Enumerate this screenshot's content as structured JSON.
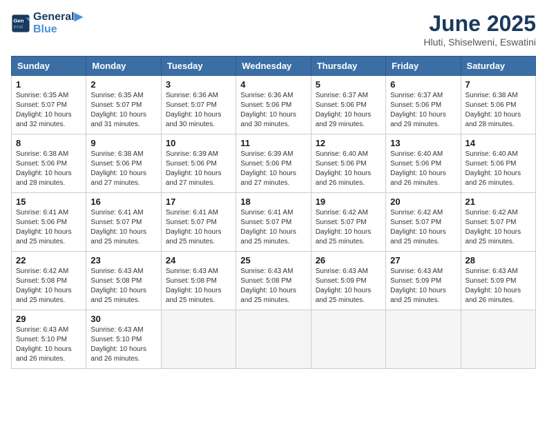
{
  "header": {
    "logo_line1": "General",
    "logo_line2": "Blue",
    "month_year": "June 2025",
    "location": "Hluti, Shiselweni, Eswatini"
  },
  "weekdays": [
    "Sunday",
    "Monday",
    "Tuesday",
    "Wednesday",
    "Thursday",
    "Friday",
    "Saturday"
  ],
  "weeks": [
    [
      {
        "day": "1",
        "info": "Sunrise: 6:35 AM\nSunset: 5:07 PM\nDaylight: 10 hours\nand 32 minutes."
      },
      {
        "day": "2",
        "info": "Sunrise: 6:35 AM\nSunset: 5:07 PM\nDaylight: 10 hours\nand 31 minutes."
      },
      {
        "day": "3",
        "info": "Sunrise: 6:36 AM\nSunset: 5:07 PM\nDaylight: 10 hours\nand 30 minutes."
      },
      {
        "day": "4",
        "info": "Sunrise: 6:36 AM\nSunset: 5:06 PM\nDaylight: 10 hours\nand 30 minutes."
      },
      {
        "day": "5",
        "info": "Sunrise: 6:37 AM\nSunset: 5:06 PM\nDaylight: 10 hours\nand 29 minutes."
      },
      {
        "day": "6",
        "info": "Sunrise: 6:37 AM\nSunset: 5:06 PM\nDaylight: 10 hours\nand 29 minutes."
      },
      {
        "day": "7",
        "info": "Sunrise: 6:38 AM\nSunset: 5:06 PM\nDaylight: 10 hours\nand 28 minutes."
      }
    ],
    [
      {
        "day": "8",
        "info": "Sunrise: 6:38 AM\nSunset: 5:06 PM\nDaylight: 10 hours\nand 28 minutes."
      },
      {
        "day": "9",
        "info": "Sunrise: 6:38 AM\nSunset: 5:06 PM\nDaylight: 10 hours\nand 27 minutes."
      },
      {
        "day": "10",
        "info": "Sunrise: 6:39 AM\nSunset: 5:06 PM\nDaylight: 10 hours\nand 27 minutes."
      },
      {
        "day": "11",
        "info": "Sunrise: 6:39 AM\nSunset: 5:06 PM\nDaylight: 10 hours\nand 27 minutes."
      },
      {
        "day": "12",
        "info": "Sunrise: 6:40 AM\nSunset: 5:06 PM\nDaylight: 10 hours\nand 26 minutes."
      },
      {
        "day": "13",
        "info": "Sunrise: 6:40 AM\nSunset: 5:06 PM\nDaylight: 10 hours\nand 26 minutes."
      },
      {
        "day": "14",
        "info": "Sunrise: 6:40 AM\nSunset: 5:06 PM\nDaylight: 10 hours\nand 26 minutes."
      }
    ],
    [
      {
        "day": "15",
        "info": "Sunrise: 6:41 AM\nSunset: 5:06 PM\nDaylight: 10 hours\nand 25 minutes."
      },
      {
        "day": "16",
        "info": "Sunrise: 6:41 AM\nSunset: 5:07 PM\nDaylight: 10 hours\nand 25 minutes."
      },
      {
        "day": "17",
        "info": "Sunrise: 6:41 AM\nSunset: 5:07 PM\nDaylight: 10 hours\nand 25 minutes."
      },
      {
        "day": "18",
        "info": "Sunrise: 6:41 AM\nSunset: 5:07 PM\nDaylight: 10 hours\nand 25 minutes."
      },
      {
        "day": "19",
        "info": "Sunrise: 6:42 AM\nSunset: 5:07 PM\nDaylight: 10 hours\nand 25 minutes."
      },
      {
        "day": "20",
        "info": "Sunrise: 6:42 AM\nSunset: 5:07 PM\nDaylight: 10 hours\nand 25 minutes."
      },
      {
        "day": "21",
        "info": "Sunrise: 6:42 AM\nSunset: 5:07 PM\nDaylight: 10 hours\nand 25 minutes."
      }
    ],
    [
      {
        "day": "22",
        "info": "Sunrise: 6:42 AM\nSunset: 5:08 PM\nDaylight: 10 hours\nand 25 minutes."
      },
      {
        "day": "23",
        "info": "Sunrise: 6:43 AM\nSunset: 5:08 PM\nDaylight: 10 hours\nand 25 minutes."
      },
      {
        "day": "24",
        "info": "Sunrise: 6:43 AM\nSunset: 5:08 PM\nDaylight: 10 hours\nand 25 minutes."
      },
      {
        "day": "25",
        "info": "Sunrise: 6:43 AM\nSunset: 5:08 PM\nDaylight: 10 hours\nand 25 minutes."
      },
      {
        "day": "26",
        "info": "Sunrise: 6:43 AM\nSunset: 5:09 PM\nDaylight: 10 hours\nand 25 minutes."
      },
      {
        "day": "27",
        "info": "Sunrise: 6:43 AM\nSunset: 5:09 PM\nDaylight: 10 hours\nand 25 minutes."
      },
      {
        "day": "28",
        "info": "Sunrise: 6:43 AM\nSunset: 5:09 PM\nDaylight: 10 hours\nand 26 minutes."
      }
    ],
    [
      {
        "day": "29",
        "info": "Sunrise: 6:43 AM\nSunset: 5:10 PM\nDaylight: 10 hours\nand 26 minutes."
      },
      {
        "day": "30",
        "info": "Sunrise: 6:43 AM\nSunset: 5:10 PM\nDaylight: 10 hours\nand 26 minutes."
      },
      {
        "day": "",
        "info": ""
      },
      {
        "day": "",
        "info": ""
      },
      {
        "day": "",
        "info": ""
      },
      {
        "day": "",
        "info": ""
      },
      {
        "day": "",
        "info": ""
      }
    ]
  ]
}
